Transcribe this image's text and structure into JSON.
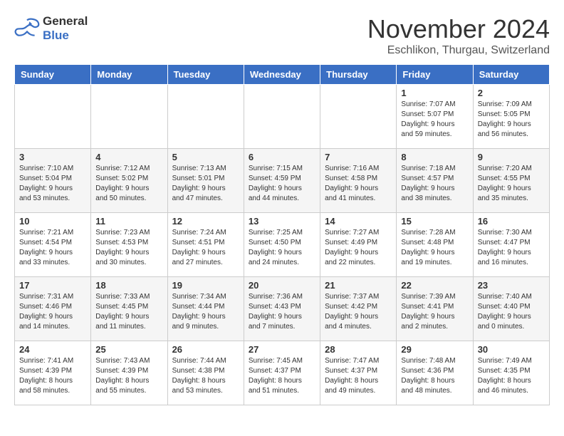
{
  "logo": {
    "line1": "General",
    "line2": "Blue"
  },
  "title": "November 2024",
  "location": "Eschlikon, Thurgau, Switzerland",
  "days_of_week": [
    "Sunday",
    "Monday",
    "Tuesday",
    "Wednesday",
    "Thursday",
    "Friday",
    "Saturday"
  ],
  "weeks": [
    [
      {
        "day": "",
        "info": ""
      },
      {
        "day": "",
        "info": ""
      },
      {
        "day": "",
        "info": ""
      },
      {
        "day": "",
        "info": ""
      },
      {
        "day": "",
        "info": ""
      },
      {
        "day": "1",
        "info": "Sunrise: 7:07 AM\nSunset: 5:07 PM\nDaylight: 9 hours and 59 minutes."
      },
      {
        "day": "2",
        "info": "Sunrise: 7:09 AM\nSunset: 5:05 PM\nDaylight: 9 hours and 56 minutes."
      }
    ],
    [
      {
        "day": "3",
        "info": "Sunrise: 7:10 AM\nSunset: 5:04 PM\nDaylight: 9 hours and 53 minutes."
      },
      {
        "day": "4",
        "info": "Sunrise: 7:12 AM\nSunset: 5:02 PM\nDaylight: 9 hours and 50 minutes."
      },
      {
        "day": "5",
        "info": "Sunrise: 7:13 AM\nSunset: 5:01 PM\nDaylight: 9 hours and 47 minutes."
      },
      {
        "day": "6",
        "info": "Sunrise: 7:15 AM\nSunset: 4:59 PM\nDaylight: 9 hours and 44 minutes."
      },
      {
        "day": "7",
        "info": "Sunrise: 7:16 AM\nSunset: 4:58 PM\nDaylight: 9 hours and 41 minutes."
      },
      {
        "day": "8",
        "info": "Sunrise: 7:18 AM\nSunset: 4:57 PM\nDaylight: 9 hours and 38 minutes."
      },
      {
        "day": "9",
        "info": "Sunrise: 7:20 AM\nSunset: 4:55 PM\nDaylight: 9 hours and 35 minutes."
      }
    ],
    [
      {
        "day": "10",
        "info": "Sunrise: 7:21 AM\nSunset: 4:54 PM\nDaylight: 9 hours and 33 minutes."
      },
      {
        "day": "11",
        "info": "Sunrise: 7:23 AM\nSunset: 4:53 PM\nDaylight: 9 hours and 30 minutes."
      },
      {
        "day": "12",
        "info": "Sunrise: 7:24 AM\nSunset: 4:51 PM\nDaylight: 9 hours and 27 minutes."
      },
      {
        "day": "13",
        "info": "Sunrise: 7:25 AM\nSunset: 4:50 PM\nDaylight: 9 hours and 24 minutes."
      },
      {
        "day": "14",
        "info": "Sunrise: 7:27 AM\nSunset: 4:49 PM\nDaylight: 9 hours and 22 minutes."
      },
      {
        "day": "15",
        "info": "Sunrise: 7:28 AM\nSunset: 4:48 PM\nDaylight: 9 hours and 19 minutes."
      },
      {
        "day": "16",
        "info": "Sunrise: 7:30 AM\nSunset: 4:47 PM\nDaylight: 9 hours and 16 minutes."
      }
    ],
    [
      {
        "day": "17",
        "info": "Sunrise: 7:31 AM\nSunset: 4:46 PM\nDaylight: 9 hours and 14 minutes."
      },
      {
        "day": "18",
        "info": "Sunrise: 7:33 AM\nSunset: 4:45 PM\nDaylight: 9 hours and 11 minutes."
      },
      {
        "day": "19",
        "info": "Sunrise: 7:34 AM\nSunset: 4:44 PM\nDaylight: 9 hours and 9 minutes."
      },
      {
        "day": "20",
        "info": "Sunrise: 7:36 AM\nSunset: 4:43 PM\nDaylight: 9 hours and 7 minutes."
      },
      {
        "day": "21",
        "info": "Sunrise: 7:37 AM\nSunset: 4:42 PM\nDaylight: 9 hours and 4 minutes."
      },
      {
        "day": "22",
        "info": "Sunrise: 7:39 AM\nSunset: 4:41 PM\nDaylight: 9 hours and 2 minutes."
      },
      {
        "day": "23",
        "info": "Sunrise: 7:40 AM\nSunset: 4:40 PM\nDaylight: 9 hours and 0 minutes."
      }
    ],
    [
      {
        "day": "24",
        "info": "Sunrise: 7:41 AM\nSunset: 4:39 PM\nDaylight: 8 hours and 58 minutes."
      },
      {
        "day": "25",
        "info": "Sunrise: 7:43 AM\nSunset: 4:39 PM\nDaylight: 8 hours and 55 minutes."
      },
      {
        "day": "26",
        "info": "Sunrise: 7:44 AM\nSunset: 4:38 PM\nDaylight: 8 hours and 53 minutes."
      },
      {
        "day": "27",
        "info": "Sunrise: 7:45 AM\nSunset: 4:37 PM\nDaylight: 8 hours and 51 minutes."
      },
      {
        "day": "28",
        "info": "Sunrise: 7:47 AM\nSunset: 4:37 PM\nDaylight: 8 hours and 49 minutes."
      },
      {
        "day": "29",
        "info": "Sunrise: 7:48 AM\nSunset: 4:36 PM\nDaylight: 8 hours and 48 minutes."
      },
      {
        "day": "30",
        "info": "Sunrise: 7:49 AM\nSunset: 4:35 PM\nDaylight: 8 hours and 46 minutes."
      }
    ]
  ]
}
